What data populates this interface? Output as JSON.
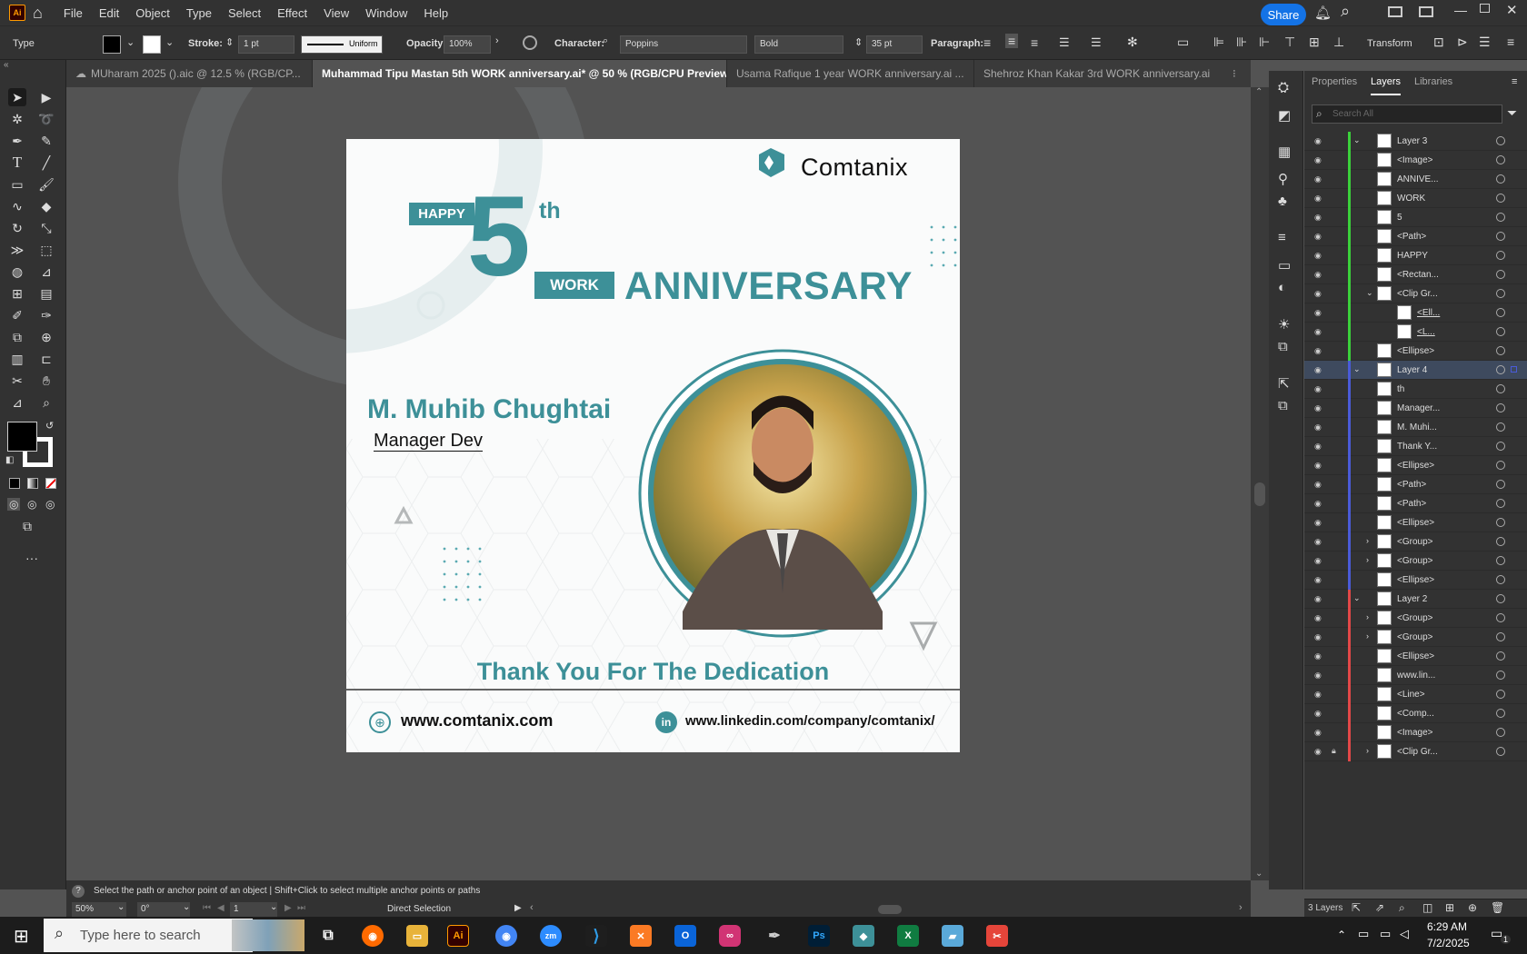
{
  "menubar": {
    "logo": "Ai",
    "items": [
      "File",
      "Edit",
      "Object",
      "Type",
      "Select",
      "Effect",
      "View",
      "Window",
      "Help"
    ],
    "share": "Share"
  },
  "control": {
    "type_label": "Type",
    "stroke_label": "Stroke:",
    "stroke_value": "1 pt",
    "stroke_style": "Uniform",
    "opacity_label": "Opacity:",
    "opacity_value": "100%",
    "character_label": "Character:",
    "font_family": "Poppins",
    "font_style": "Bold",
    "font_size": "35 pt",
    "paragraph_label": "Paragraph:",
    "transform_label": "Transform"
  },
  "tabs": [
    {
      "label": "MUharam 2025 ().aic @ 12.5 % (RGB/CP...",
      "active": false
    },
    {
      "label": "Muhammad Tipu Mastan   5th  WORK anniversary.ai* @ 50 % (RGB/CPU Preview)",
      "active": true
    },
    {
      "label": "Usama Rafique 1 year WORK anniversary.ai ...",
      "active": false
    },
    {
      "label": "Shehroz Khan Kakar   3rd  WORK anniversary.ai",
      "active": false
    }
  ],
  "artboard": {
    "brand": "Comtanix",
    "happy": "HAPPY",
    "number": "5",
    "suffix": "th",
    "work": "WORK",
    "anniversary": "ANNIVERSARY",
    "name": "M. Muhib Chughtai",
    "role": "Manager Dev",
    "thanks": "Thank You For The Dedication",
    "website": "www.comtanix.com",
    "linkedin": "www.linkedin.com/company/comtanix/",
    "linkedin_icon": "in",
    "accent": "#3d9098",
    "dark": "#0c0c0c"
  },
  "panel": {
    "tabs": [
      "Properties",
      "Layers",
      "Libraries"
    ],
    "search_placeholder": "Search All",
    "footer": "3 Layers",
    "layers": [
      {
        "name": "Layer 3",
        "indent": 0,
        "color": "#3bd13b",
        "expand": "v",
        "sel": false
      },
      {
        "name": "<Image>",
        "indent": 2,
        "color": "#3bd13b",
        "expand": "",
        "sel": false
      },
      {
        "name": "ANNIVE...",
        "indent": 2,
        "color": "#3bd13b",
        "expand": "",
        "sel": false
      },
      {
        "name": "WORK",
        "indent": 2,
        "color": "#3bd13b",
        "expand": "",
        "sel": false
      },
      {
        "name": "5",
        "indent": 2,
        "color": "#3bd13b",
        "expand": "",
        "sel": false
      },
      {
        "name": "<Path>",
        "indent": 2,
        "color": "#3bd13b",
        "expand": "",
        "sel": false
      },
      {
        "name": "HAPPY",
        "indent": 2,
        "color": "#3bd13b",
        "expand": "",
        "sel": false
      },
      {
        "name": "<Rectan...",
        "indent": 2,
        "color": "#3bd13b",
        "expand": "",
        "sel": false
      },
      {
        "name": "<Clip Gr...",
        "indent": 2,
        "color": "#3bd13b",
        "expand": "v",
        "sel": false
      },
      {
        "name": "<Ell...",
        "indent": 3,
        "color": "#3bd13b",
        "expand": "",
        "sel": false
      },
      {
        "name": "<L...",
        "indent": 3,
        "color": "#3bd13b",
        "expand": "",
        "sel": false
      },
      {
        "name": "<Ellipse>",
        "indent": 2,
        "color": "#3bd13b",
        "expand": "",
        "sel": false
      },
      {
        "name": "Layer 4",
        "indent": 0,
        "color": "#4a5bd8",
        "expand": "v",
        "sel": true
      },
      {
        "name": "th",
        "indent": 2,
        "color": "#4a5bd8",
        "expand": "",
        "sel": false
      },
      {
        "name": "Manager...",
        "indent": 2,
        "color": "#4a5bd8",
        "expand": "",
        "sel": false
      },
      {
        "name": "M. Muhi...",
        "indent": 2,
        "color": "#4a5bd8",
        "expand": "",
        "sel": false
      },
      {
        "name": "Thank Y...",
        "indent": 2,
        "color": "#4a5bd8",
        "expand": "",
        "sel": false
      },
      {
        "name": "<Ellipse>",
        "indent": 2,
        "color": "#4a5bd8",
        "expand": "",
        "sel": false
      },
      {
        "name": "<Path>",
        "indent": 2,
        "color": "#4a5bd8",
        "expand": "",
        "sel": false
      },
      {
        "name": "<Path>",
        "indent": 2,
        "color": "#4a5bd8",
        "expand": "",
        "sel": false
      },
      {
        "name": "<Ellipse>",
        "indent": 2,
        "color": "#4a5bd8",
        "expand": "",
        "sel": false
      },
      {
        "name": "<Group>",
        "indent": 2,
        "color": "#4a5bd8",
        "expand": ">",
        "sel": false
      },
      {
        "name": "<Group>",
        "indent": 2,
        "color": "#4a5bd8",
        "expand": ">",
        "sel": false
      },
      {
        "name": "<Ellipse>",
        "indent": 2,
        "color": "#4a5bd8",
        "expand": "",
        "sel": false
      },
      {
        "name": "Layer 2",
        "indent": 0,
        "color": "#e34848",
        "expand": "v",
        "sel": false
      },
      {
        "name": "<Group>",
        "indent": 2,
        "color": "#e34848",
        "expand": ">",
        "sel": false
      },
      {
        "name": "<Group>",
        "indent": 2,
        "color": "#e34848",
        "expand": ">",
        "sel": false
      },
      {
        "name": "<Ellipse>",
        "indent": 2,
        "color": "#e34848",
        "expand": "",
        "sel": false
      },
      {
        "name": "www.lin...",
        "indent": 2,
        "color": "#e34848",
        "expand": "",
        "sel": false
      },
      {
        "name": "<Line>",
        "indent": 2,
        "color": "#e34848",
        "expand": "",
        "sel": false
      },
      {
        "name": "<Comp...",
        "indent": 2,
        "color": "#e34848",
        "expand": "",
        "sel": false
      },
      {
        "name": "<Image>",
        "indent": 2,
        "color": "#e34848",
        "expand": "",
        "sel": false
      },
      {
        "name": "<Clip Gr...",
        "indent": 2,
        "color": "#e34848",
        "expand": ">",
        "sel": false
      }
    ]
  },
  "status": {
    "hint": "Select the path or anchor point of an object  |  Shift+Click to select multiple anchor points or paths",
    "zoom": "50%",
    "rotation": "0°",
    "artboard_num": "1",
    "tool": "Direct Selection"
  },
  "taskbar": {
    "search": "Type here to search",
    "time": "6:29 AM",
    "date": "7/2/2025",
    "notif": "1"
  }
}
